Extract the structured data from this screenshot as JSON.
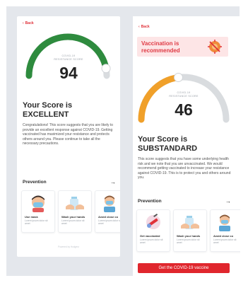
{
  "screen_excellent": {
    "back_label": "Back",
    "gauge_label": "COVID-19\nRESISTANCE SCORE",
    "score": "94",
    "score_level": 0.94,
    "title": "Your Score is\nEXCELLENT",
    "description": "Congratulations! This score suggests that you are likely to provide an excellent response against COVID-19. Getting vaccinated has maximized your resistance and protects others around you. Please continue to take all the necessary precautions.",
    "prevention_label": "Prevention",
    "cards": [
      {
        "title": "Use mask",
        "desc": "Lorem ipsum dolor sit amet",
        "icon": "mask-icon"
      },
      {
        "title": "Wash your hands",
        "desc": "Lorem ipsum dolor sit amet",
        "icon": "handwash-icon"
      },
      {
        "title": "Avoid close co",
        "desc": "Lorem ipsum dolor sit amet",
        "icon": "distance-icon"
      }
    ],
    "footer": "Powered by Hodgesr"
  },
  "screen_substandard": {
    "back_label": "Back",
    "banner": "Vaccination is\nrecommended",
    "gauge_label": "COVID-19\nRESISTANCE SCORE",
    "score": "46",
    "score_level": 0.46,
    "title": "Your Score is\nSUBSTANDARD",
    "description": "This score suggests that you have some underlying health risk and we note that you are unvaccinated. We would recommend getting vaccinated to increase your resistance against COVID-19. This is to protect you and others around you.",
    "prevention_label": "Prevention",
    "cards": [
      {
        "title": "Get vaccinated",
        "desc": "Lorem ipsum dolor sit amet",
        "icon": "vaccine-icon"
      },
      {
        "title": "Wash your hands",
        "desc": "Lorem ipsum dolor sit amet",
        "icon": "handwash-icon"
      },
      {
        "title": "Avoid close co",
        "desc": "Lorem ipsum dolor sit amet",
        "icon": "distance-icon"
      }
    ],
    "cta": "Get the COVID-19 vaccine"
  },
  "colors": {
    "excellent_gauge": "#2e8b3e",
    "substandard_gauge": "#f0a02a",
    "gauge_track": "#d9dcdf",
    "accent_red": "#e0262d"
  }
}
